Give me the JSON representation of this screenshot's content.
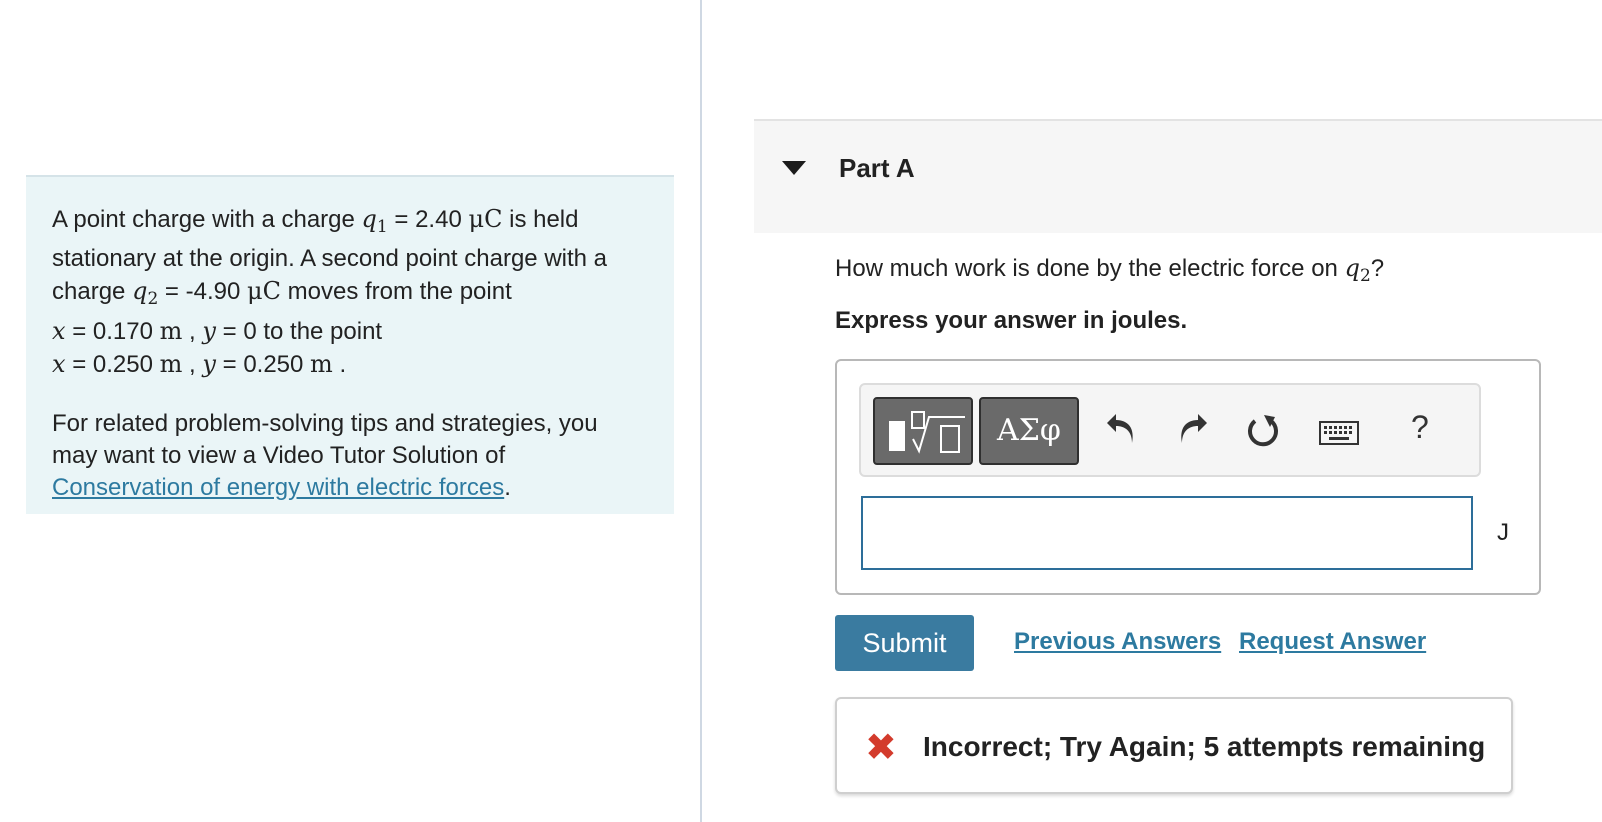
{
  "problem": {
    "p1_a": "A point charge with a charge ",
    "q1_symbol": "q",
    "q1_sub": "1",
    "p1_b": " = 2.40 ",
    "mu": "μC",
    "p1_c": " is held stationary at the origin. A second point charge with a charge ",
    "q2_symbol": "q",
    "q2_sub": "2",
    "p1_d": " = -4.90 ",
    "mu2": "μC",
    "p1_e": " moves from the point",
    "line4_x": "x",
    "line4_eq": " = 0.170 ",
    "unit_m": "m",
    "line4_comma": " , ",
    "line4_y": "y",
    "line4_rest": " = 0 to the point",
    "line5_x": "x",
    "line5_eq": " = 0.250 ",
    "unit_m2": "m",
    "line5_comma": " , ",
    "line5_y": "y",
    "line5_eq2": " = 0.250 ",
    "unit_m3": "m",
    "line5_end": " .",
    "p2": "For related problem-solving tips and strategies, you may want to view a Video Tutor Solution of ",
    "p2_link": "Conservation of energy with electric forces",
    "p2_end": "."
  },
  "part": {
    "title": "Part A",
    "question_a": "How much work is done by the electric force on ",
    "question_sym": "q",
    "question_sub": "2",
    "question_end": "?",
    "instruction": "Express your answer in joules."
  },
  "toolbar": {
    "symbols_label": "ΑΣφ",
    "help_label": "?",
    "icons": [
      "templates-icon",
      "greek-symbols-icon",
      "undo-icon",
      "redo-icon",
      "reset-icon",
      "keyboard-icon",
      "help-icon"
    ]
  },
  "answer": {
    "value": "",
    "unit": "J"
  },
  "actions": {
    "submit": "Submit",
    "previous": "Previous Answers",
    "request": "Request Answer"
  },
  "feedback": {
    "icon": "✖",
    "text": "Incorrect; Try Again; 5 attempts remaining"
  },
  "colors": {
    "accent": "#3a7ba0",
    "link": "#2d7aa0",
    "problem_bg": "#eaf5f7",
    "error": "#d33b2c"
  }
}
